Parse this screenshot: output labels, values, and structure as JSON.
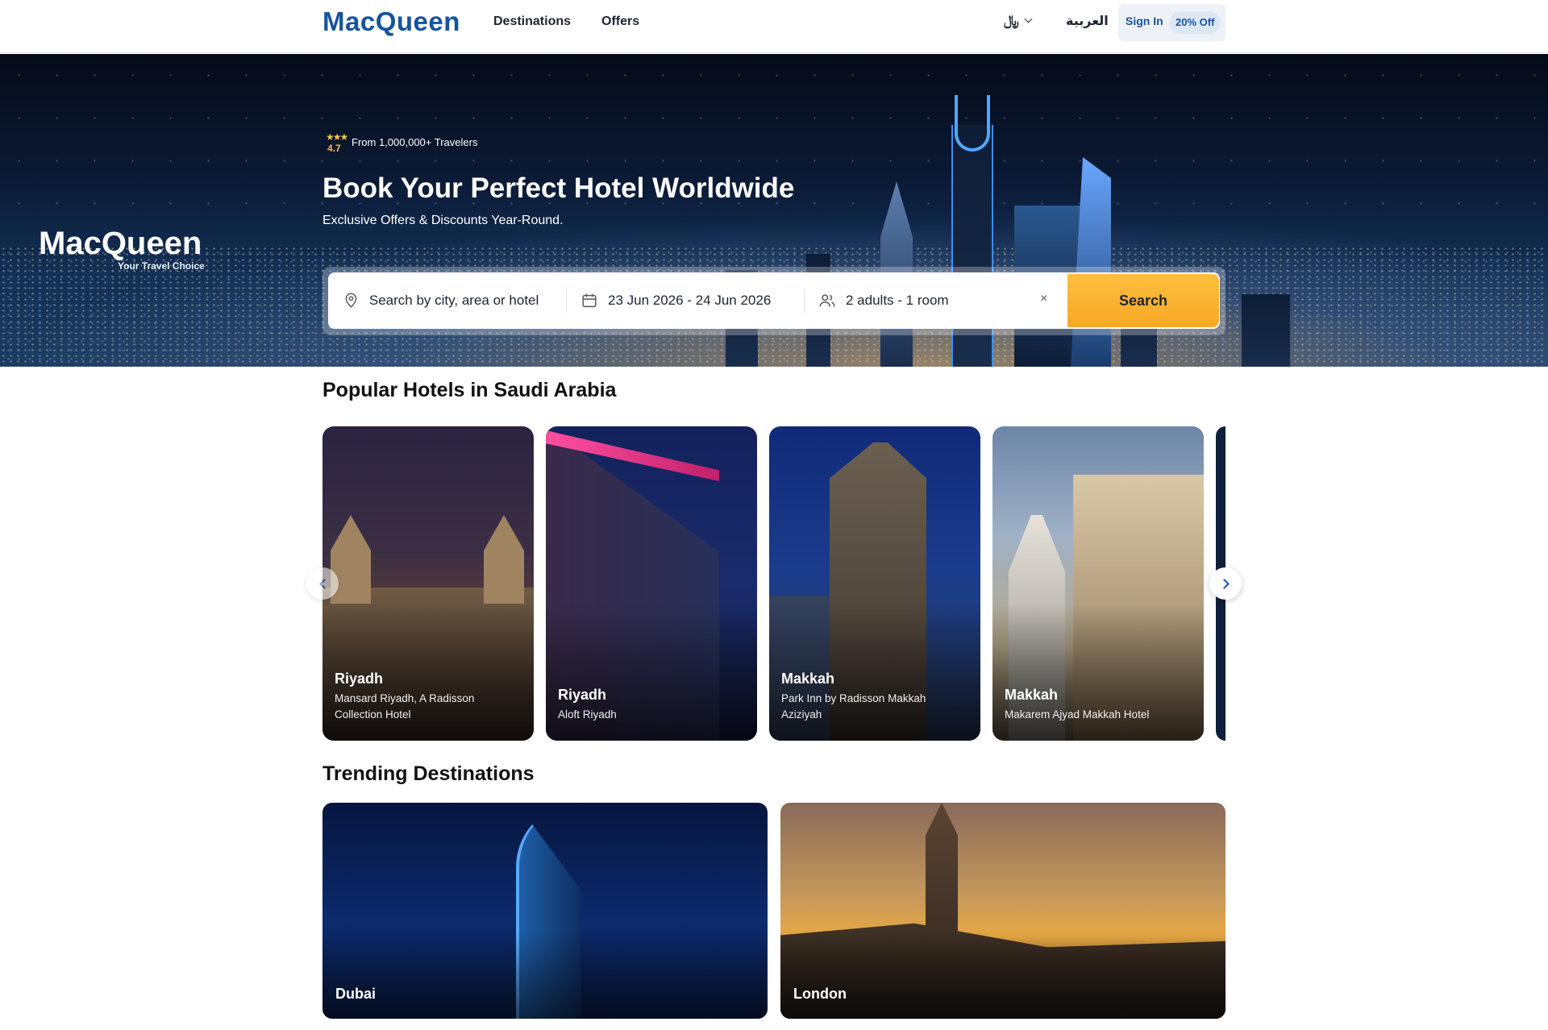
{
  "header": {
    "logo": "MacQueen",
    "nav": [
      "Destinations",
      "Offers"
    ],
    "currency": "﷼",
    "language": "العربية",
    "sign_in": "Sign In",
    "discount_badge": "20% Off"
  },
  "hero": {
    "logo": "MacQueen",
    "tagline": "Your Travel Choice",
    "rating": "4.7",
    "rating_text": "From 1,000,000+ Travelers",
    "title": "Book Your Perfect Hotel Worldwide",
    "subtitle": "Exclusive Offers & Discounts Year-Round.",
    "search": {
      "location_placeholder": "Search by city, area or hotel",
      "dates": "23 Jun 2026 - 24 Jun 2026",
      "guests": "2 adults - 1 room",
      "clear": "×",
      "button": "Search"
    }
  },
  "popular": {
    "title": "Popular Hotels in Saudi Arabia",
    "hotels": [
      {
        "city": "Riyadh",
        "name": "Mansard Riyadh, A Radisson Collection Hotel"
      },
      {
        "city": "Riyadh",
        "name": "Aloft Riyadh"
      },
      {
        "city": "Makkah",
        "name": "Park Inn by Radisson Makkah Aziziyah"
      },
      {
        "city": "Makkah",
        "name": "Makarem Ajyad Makkah Hotel"
      }
    ]
  },
  "trending": {
    "title": "Trending Destinations",
    "destinations": [
      {
        "name": "Dubai"
      },
      {
        "name": "London"
      }
    ]
  },
  "colors": {
    "brand": "#15539d",
    "accent": "#f9a825"
  },
  "icons": {
    "location": "map-pin-icon",
    "calendar": "calendar-icon",
    "guests": "users-icon",
    "rating": "stars-icon"
  }
}
